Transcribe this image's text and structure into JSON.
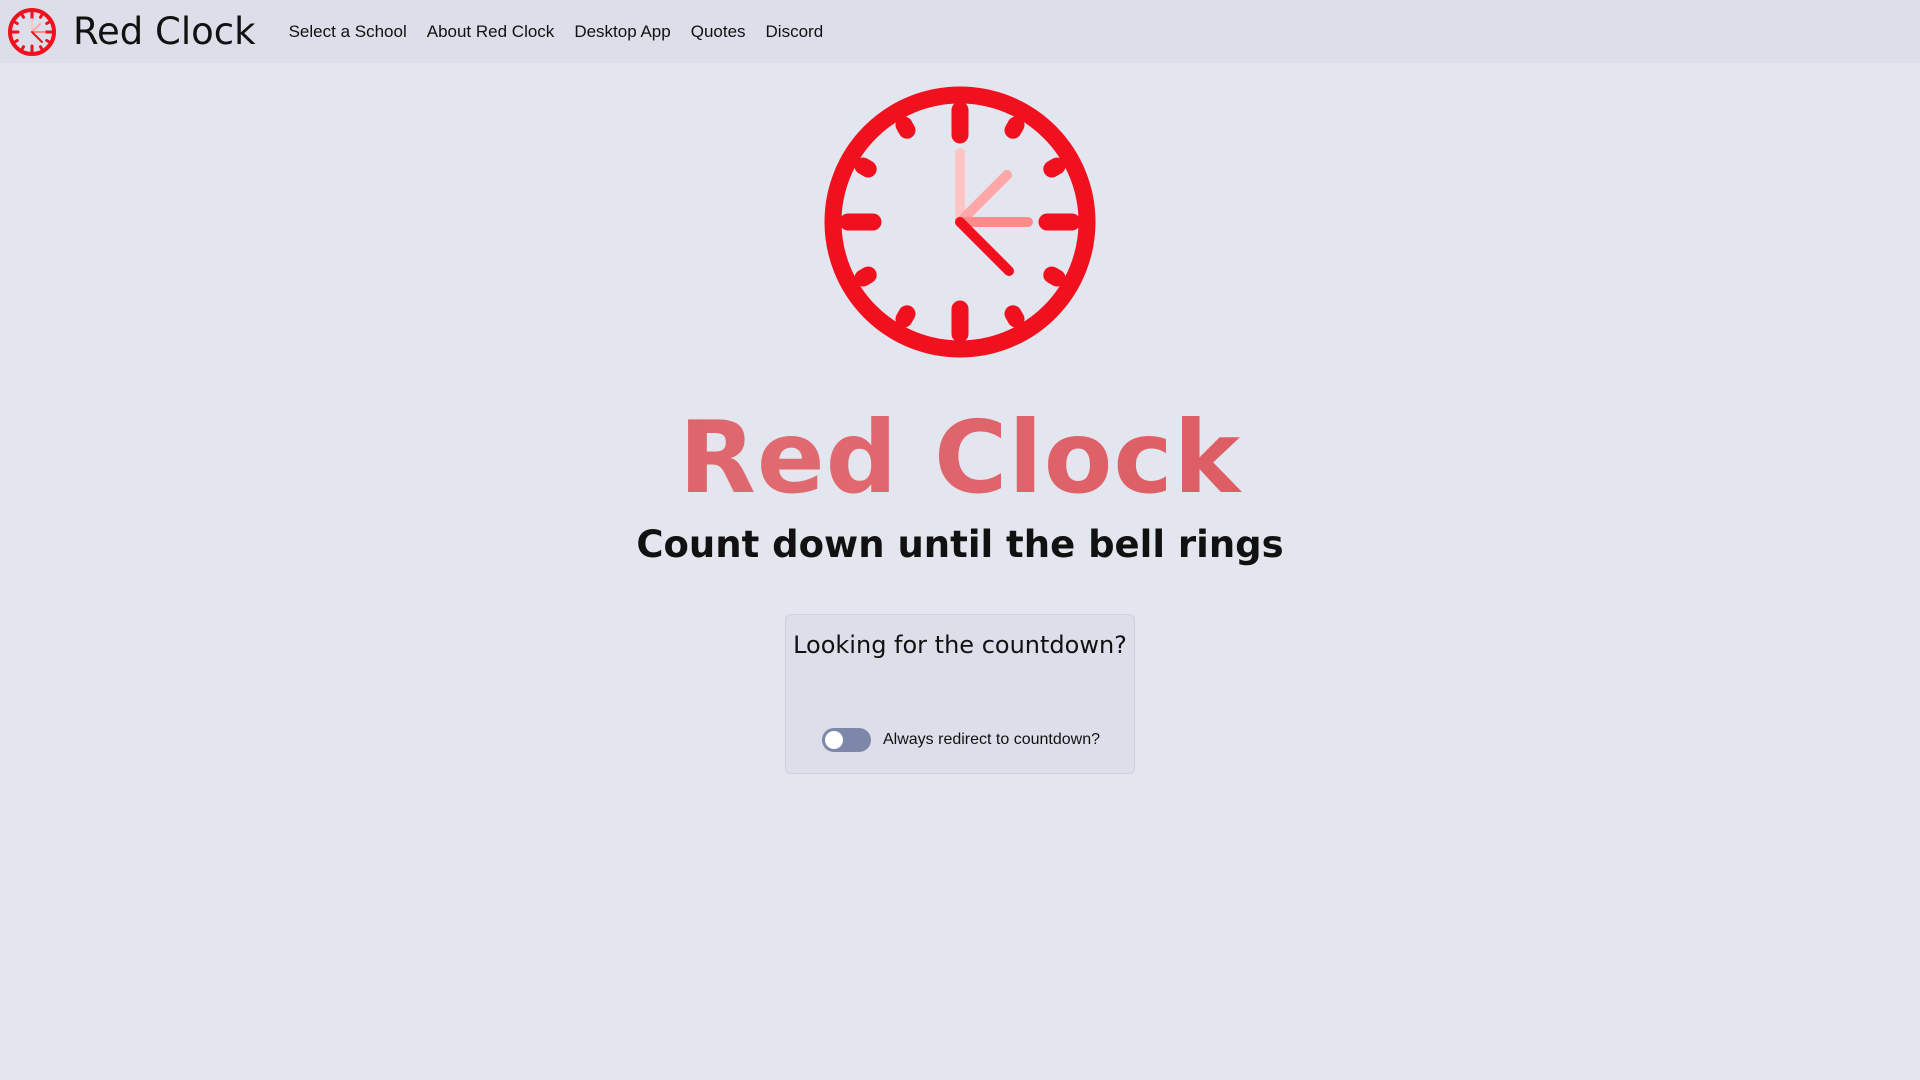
{
  "navbar": {
    "brand": "Red Clock",
    "links": [
      {
        "label": "Select a School"
      },
      {
        "label": "About Red Clock"
      },
      {
        "label": "Desktop App"
      },
      {
        "label": "Quotes"
      },
      {
        "label": "Discord"
      }
    ]
  },
  "hero": {
    "title": "Red Clock",
    "subtitle": "Count down until the bell rings"
  },
  "card": {
    "title": "Looking for the countdown?",
    "toggle_label": "Always redirect to countdown?",
    "toggle_on": false
  },
  "icons": {
    "brand_logo": "red-clock-icon",
    "hero_logo": "red-clock-icon"
  },
  "colors": {
    "clock_red": "#f0101e",
    "hand_pink": "#ffa6a6",
    "title_red": "#d4454c",
    "toggle_track": "#7d87aa",
    "page_bg": "#e3e6ee",
    "nav_bg": "#dcdfe9"
  }
}
